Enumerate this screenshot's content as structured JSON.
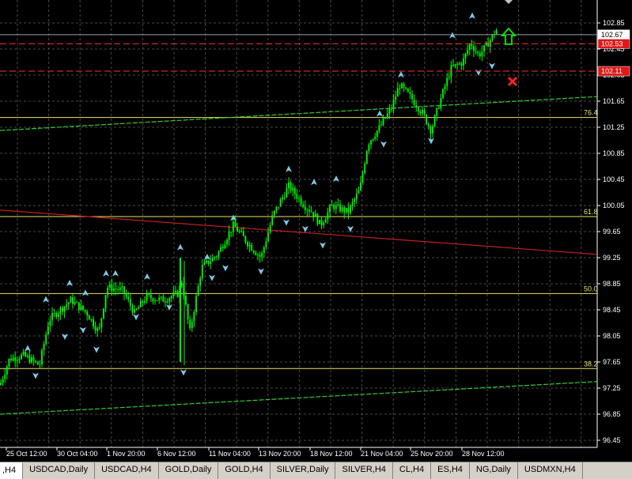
{
  "chart": {
    "price_ticks": [
      "102.85",
      "102.45",
      "102.05",
      "101.65",
      "101.25",
      "100.85",
      "100.45",
      "100.05",
      "99.65",
      "99.25",
      "98.85",
      "98.45",
      "98.05",
      "97.65",
      "97.25",
      "96.85",
      "96.45"
    ],
    "time_ticks": [
      "25 Oct 12:00",
      "30 Oct 04:00",
      "1 Nov 20:00",
      "6 Nov 12:00",
      "11 Nov 04:00",
      "13 Nov 20:00",
      "18 Nov 12:00",
      "21 Nov 04:00",
      "25 Nov 20:00",
      "28 Nov 12:00"
    ],
    "current_price": "102.67",
    "buy_stop": "102.53",
    "sell_stop": "102.11",
    "fib_levels": [
      {
        "label": "76.4",
        "price": 101.4
      },
      {
        "label": "61.8",
        "price": 99.88
      },
      {
        "label": "50.0",
        "price": 98.7
      },
      {
        "label": "38.2",
        "price": 97.55
      }
    ],
    "colors": {
      "candles": "#00ff00",
      "fractals": "#7ec8e8",
      "fib": "#e9e36a",
      "buy_line": "#ff3030",
      "grid": "#4a4a4a",
      "trend_red": "#c02020",
      "trend_green": "#33cc33",
      "arrow_up": "#00ee00",
      "cross": "#ff2020"
    }
  },
  "tabs": [
    {
      "label": ",H4",
      "active": true
    },
    {
      "label": "USDCAD,Daily",
      "active": false
    },
    {
      "label": "USDCAD,H4",
      "active": false
    },
    {
      "label": "GOLD,Daily",
      "active": false
    },
    {
      "label": "GOLD,H4",
      "active": false
    },
    {
      "label": "SILVER,Daily",
      "active": false
    },
    {
      "label": "SILVER,H4",
      "active": false
    },
    {
      "label": "CL,H4",
      "active": false
    },
    {
      "label": "ES,H4",
      "active": false
    },
    {
      "label": "NG,Daily",
      "active": false
    },
    {
      "label": "USDMXN,H4",
      "active": false
    }
  ]
}
